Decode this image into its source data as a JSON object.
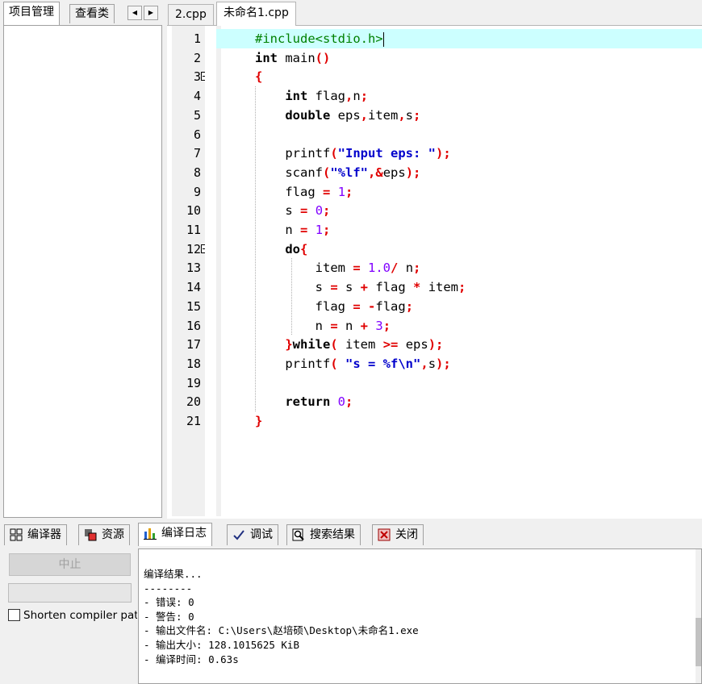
{
  "left_tabs": {
    "project": "项目管理",
    "classes": "查看类",
    "prev_arrow": "◀",
    "next_arrow": "▶"
  },
  "editor_tabs": [
    "2.cpp",
    "未命名1.cpp"
  ],
  "code_lines": [
    {
      "n": "1",
      "html": "<span class=\"pp\">#include&lt;stdio.h&gt;</span>"
    },
    {
      "n": "2",
      "html": "<span class=\"kw\">int</span> main<span class=\"op\">()</span>"
    },
    {
      "n": "3",
      "html": "<span class=\"op\">{</span>"
    },
    {
      "n": "4",
      "html": "    <span class=\"kw\">int</span> flag<span class=\"op\">,</span>n<span class=\"op\">;</span>"
    },
    {
      "n": "5",
      "html": "    <span class=\"kw\">double</span> eps<span class=\"op\">,</span>item<span class=\"op\">,</span>s<span class=\"op\">;</span>"
    },
    {
      "n": "6",
      "html": ""
    },
    {
      "n": "7",
      "html": "    printf<span class=\"op\">(</span><span class=\"str\">\"Input eps: \"</span><span class=\"op\">);</span>"
    },
    {
      "n": "8",
      "html": "    scanf<span class=\"op\">(</span><span class=\"str\">\"%lf\"</span><span class=\"op\">,&amp;</span>eps<span class=\"op\">);</span>"
    },
    {
      "n": "9",
      "html": "    flag <span class=\"op\">=</span> <span class=\"num\">1</span><span class=\"op\">;</span>"
    },
    {
      "n": "10",
      "html": "    s <span class=\"op\">=</span> <span class=\"num\">0</span><span class=\"op\">;</span>"
    },
    {
      "n": "11",
      "html": "    n <span class=\"op\">=</span> <span class=\"num\">1</span><span class=\"op\">;</span>"
    },
    {
      "n": "12",
      "html": "    <span class=\"kw\">do</span><span class=\"op\">{</span>"
    },
    {
      "n": "13",
      "html": "        item <span class=\"op\">=</span> <span class=\"num\">1.0</span><span class=\"op\">/</span> n<span class=\"op\">;</span>"
    },
    {
      "n": "14",
      "html": "        s <span class=\"op\">=</span> s <span class=\"op\">+</span> flag <span class=\"op\">*</span> item<span class=\"op\">;</span>"
    },
    {
      "n": "15",
      "html": "        flag <span class=\"op\">=</span> <span class=\"op\">-</span>flag<span class=\"op\">;</span>"
    },
    {
      "n": "16",
      "html": "        n <span class=\"op\">=</span> n <span class=\"op\">+</span> <span class=\"num\">3</span><span class=\"op\">;</span>"
    },
    {
      "n": "17",
      "html": "    <span class=\"op\">}</span><span class=\"kw\">while</span><span class=\"op\">(</span> item <span class=\"op\">&gt;=</span> eps<span class=\"op\">);</span>"
    },
    {
      "n": "18",
      "html": "    printf<span class=\"op\">(</span> <span class=\"str\">\"s = %f\\n\"</span><span class=\"op\">,</span>s<span class=\"op\">);</span>"
    },
    {
      "n": "19",
      "html": ""
    },
    {
      "n": "20",
      "html": "    <span class=\"kw\">return</span> <span class=\"num\">0</span><span class=\"op\">;</span>"
    },
    {
      "n": "21",
      "html": "<span class=\"op\">}</span>"
    }
  ],
  "bottom_tabs": [
    {
      "label": "编译器",
      "icon": "grid-icon"
    },
    {
      "label": "资源",
      "icon": "resources-icon"
    },
    {
      "label": "编译日志",
      "icon": "bar-chart-icon"
    },
    {
      "label": "调试",
      "icon": "checkmark-icon"
    },
    {
      "label": "搜索结果",
      "icon": "magnifier-icon"
    },
    {
      "label": "关闭",
      "icon": "close-icon"
    }
  ],
  "compiler_panel": {
    "stop_label": "中止",
    "shorten_label": "Shorten compiler paths"
  },
  "log_lines": [
    "编译结果...",
    "--------",
    "- 错误: 0",
    "- 警告: 0",
    "- 输出文件名: C:\\Users\\赵培硕\\Desktop\\未命名1.exe",
    "- 输出大小: 128.1015625 KiB",
    "- 编译时间: 0.63s"
  ],
  "colors": {
    "current_line": "#ccffff",
    "operator": "#e00000",
    "string": "#0000cc",
    "number": "#8000ff",
    "preprocessor": "#008000"
  }
}
